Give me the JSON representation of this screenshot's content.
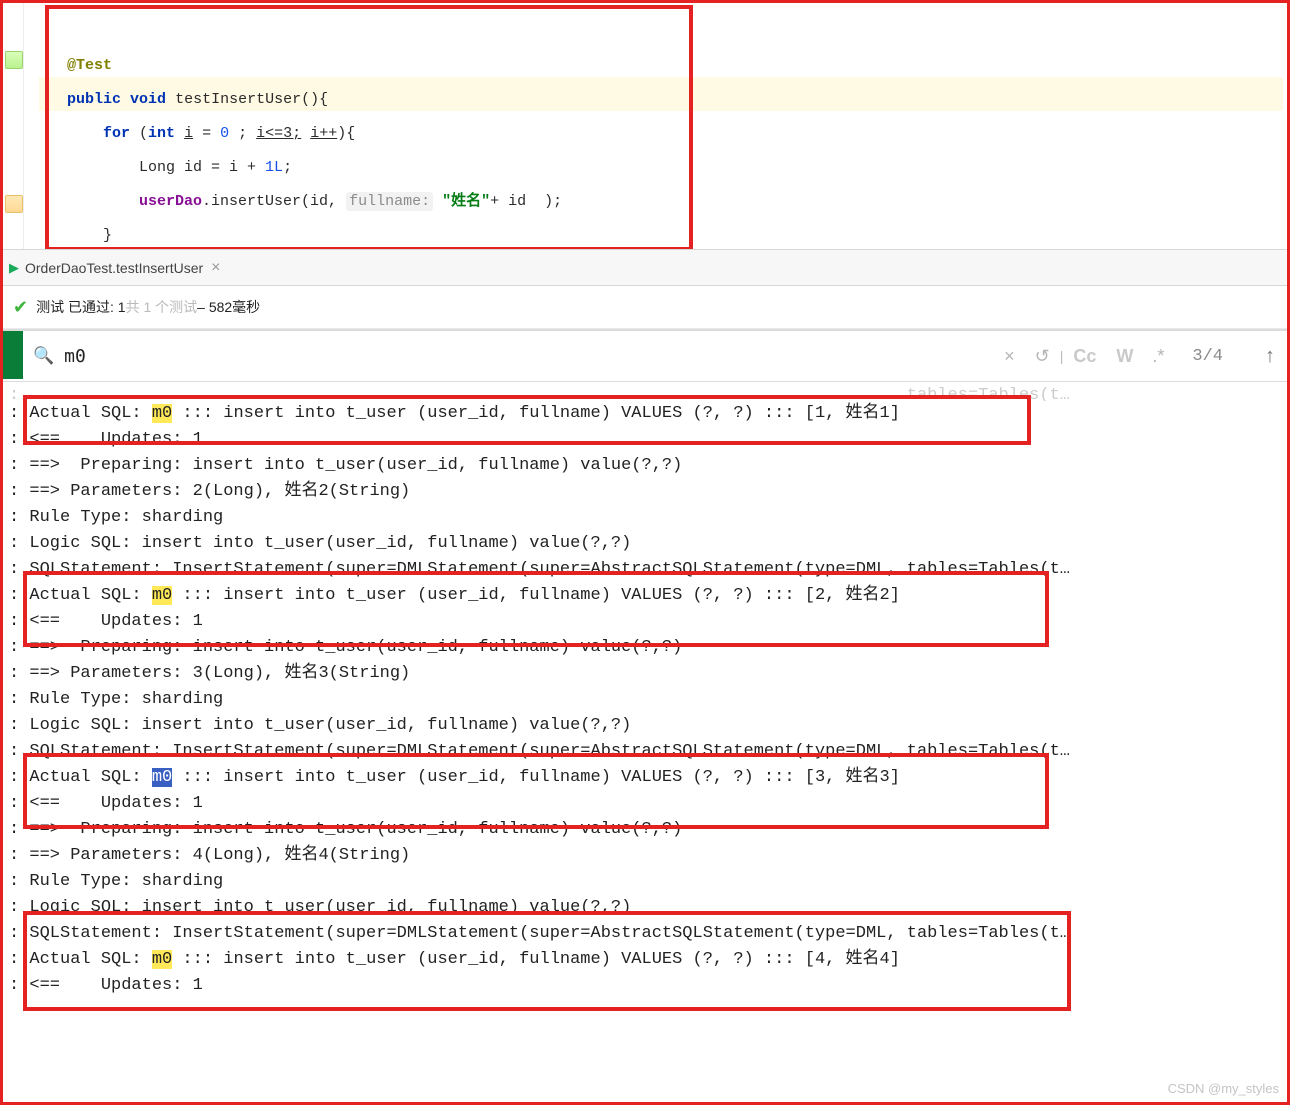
{
  "editor": {
    "annotation": "@Test",
    "kw_public": "public",
    "kw_void": "void",
    "method": "testInsertUser(){",
    "kw_for": "for",
    "kw_int": "int",
    "loopvar": "i",
    "eq": "=",
    "zero": "0",
    "cond": "i<=3;",
    "inc": "i++",
    "brace": "){",
    "idline": "Long id = i + ",
    "one": "1L",
    "call_obj": "userDao",
    "call_dot": ".insertUser(id, ",
    "hint": "fullname:",
    "str": "\"姓名\"",
    "tail": "+ id  );",
    "rbrace": "}"
  },
  "tab": {
    "name": "OrderDaoTest.testInsertUser"
  },
  "status": {
    "prefix": "测试 已通过: 1",
    "gray": "共 1 个测试",
    "suffix": " – 582毫秒"
  },
  "search": {
    "query": "m0",
    "count": "3/4"
  },
  "console": {
    "hidden0": ": ……………………………………………………………………………………………………………………………………………………………………………………………………………………………………tables=Tables(t…",
    "a1a": ": Actual SQL: ",
    "m0": "m0",
    "a1b": " ::: insert into t_user (user_id, fullname) VALUES (?, ?) ::: [1, 姓名1]",
    "u1": ": <==    Updates: 1",
    "p2": ": ==>  Preparing: insert into t_user(user_id, fullname) value(?,?)",
    "pa2": ": ==> Parameters: 2(Long), 姓名2(String)",
    "rt": ": Rule Type: sharding",
    "ls": ": Logic SQL: insert into t_user(user_id, fullname) value(?,?)",
    "ss": ": SQLStatement: InsertStatement(super=DMLStatement(super=AbstractSQLStatement(type=DML, tables=Tables(t…",
    "a2b": " ::: insert into t_user (user_id, fullname) VALUES (?, ?) ::: [2, 姓名2]",
    "u2": ": <==    Updates: 1",
    "p3": ": ==>  Preparing: insert into t_user(user_id, fullname) value(?,?)",
    "pa3": ": ==> Parameters: 3(Long), 姓名3(String)",
    "a3b": " ::: insert into t_user (user_id, fullname) VALUES (?, ?) ::: [3, 姓名3]",
    "p4": ": ==>  Preparing: insert into t_user(user_id, fullname) value(?,?)",
    "pa4": ": ==> Parameters: 4(Long), 姓名4(String)",
    "ssfull": ": SQLStatement: InsertStatement(super=DMLStatement(super=AbstractSQLStatement(type=DML, tables=Tables(t…",
    "a4b": " ::: insert into t_user (user_id, fullname) VALUES (?, ?) ::: [4, 姓名4]"
  },
  "watermark": "CSDN @my_styles"
}
